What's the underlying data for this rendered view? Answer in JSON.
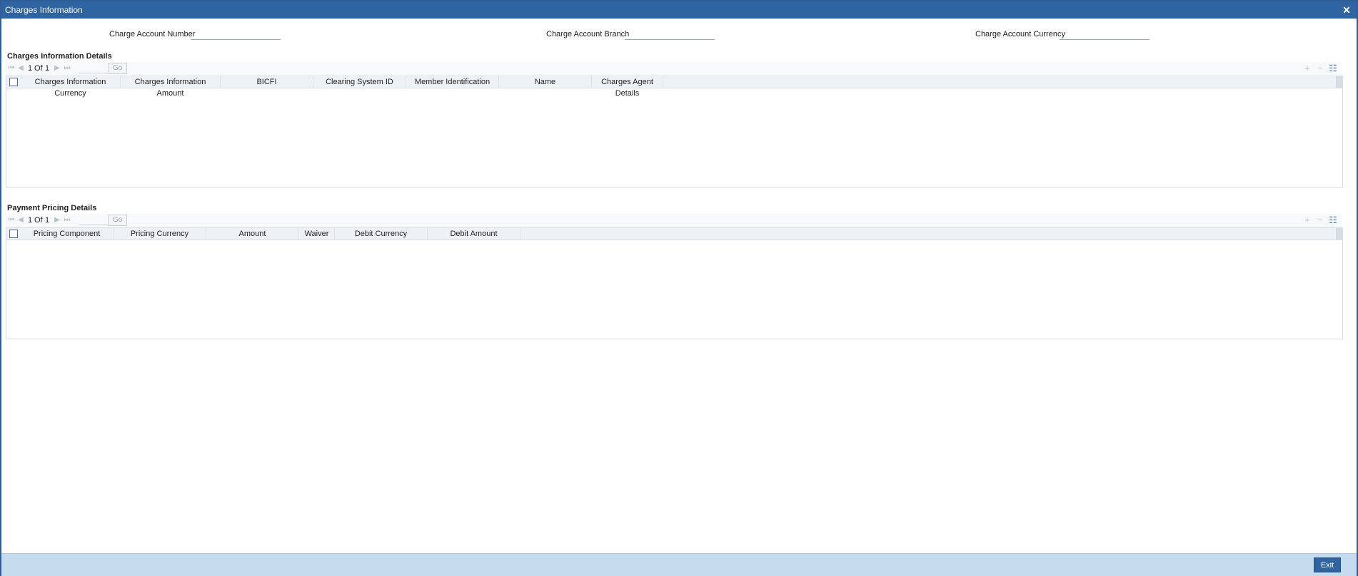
{
  "window": {
    "title": "Charges Information"
  },
  "header_fields": {
    "charge_account_number": {
      "label": "Charge Account Number",
      "value": ""
    },
    "charge_account_branch": {
      "label": "Charge Account Branch",
      "value": ""
    },
    "charge_account_currency": {
      "label": "Charge Account Currency",
      "value": ""
    }
  },
  "charges_section": {
    "title": "Charges Information Details",
    "pager": {
      "current": "1",
      "of_label": "Of",
      "total": "1",
      "go_label": "Go"
    },
    "columns": [
      "Charges Information Currency",
      "Charges Information Amount",
      "BICFI",
      "Clearing System ID",
      "Member Identification",
      "Name",
      "Charges Agent Details"
    ],
    "rows": []
  },
  "pricing_section": {
    "title": "Payment Pricing Details",
    "pager": {
      "current": "1",
      "of_label": "Of",
      "total": "1",
      "go_label": "Go"
    },
    "columns": [
      "Pricing Component",
      "Pricing Currency",
      "Amount",
      "Waiver",
      "Debit Currency",
      "Debit Amount"
    ],
    "rows": []
  },
  "footer": {
    "exit_label": "Exit"
  },
  "icons": {
    "close": "close-icon",
    "first": "first-page-icon",
    "prev": "prev-page-icon",
    "next": "next-page-icon",
    "last": "last-page-icon",
    "add": "add-row-icon",
    "delete": "delete-row-icon",
    "view": "single-view-icon"
  },
  "colors": {
    "titlebar": "#2f64a3",
    "footer": "#c5dcef",
    "accent": "#4a7fbf"
  }
}
